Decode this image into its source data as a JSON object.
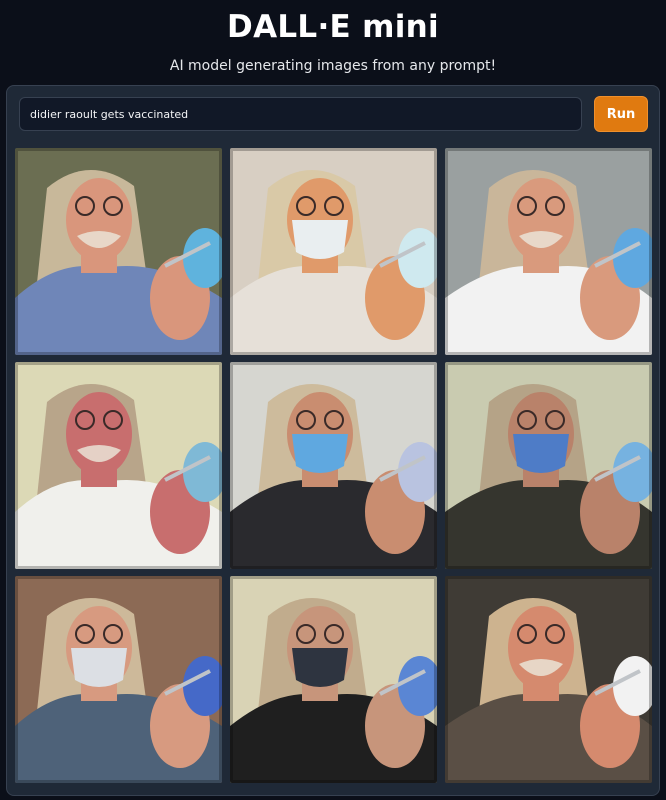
{
  "app": {
    "title": "DALL·E mini",
    "subtitle": "AI model generating images from any prompt!"
  },
  "prompt": {
    "value": "didier raoult gets vaccinated",
    "placeholder": ""
  },
  "run_button": {
    "label": "Run"
  },
  "colors": {
    "background": "#0b0f19",
    "panel": "#1f2937",
    "accent": "#e07a10"
  },
  "gallery": {
    "images": [
      {
        "bg": "#6b6e52",
        "shirt": "#6f86b8",
        "skin": "#d9967c",
        "hair": "#c8b89a",
        "mask": "none",
        "glove": "#5fb3dd"
      },
      {
        "bg": "#d8cfc3",
        "shirt": "#e6e0d8",
        "skin": "#e09a6a",
        "hair": "#d9c9a7",
        "mask": "#e9eef0",
        "glove": "#cfe9ef"
      },
      {
        "bg": "#9aa0a0",
        "shirt": "#f2f2f2",
        "skin": "#d99a7d",
        "hair": "#c9b69a",
        "mask": "none",
        "glove": "#5fa8e0"
      },
      {
        "bg": "#dcd9b6",
        "shirt": "#f0f0ec",
        "skin": "#c86e6e",
        "hair": "#b8a58a",
        "mask": "none",
        "glove": "#7fb9d6"
      },
      {
        "bg": "#d6d6d0",
        "shirt": "#2a2a2e",
        "skin": "#c98d70",
        "hair": "#cdbb9c",
        "mask": "#5fa8e0",
        "glove": "#b9c3e0"
      },
      {
        "bg": "#c9cbb0",
        "shirt": "#35352e",
        "skin": "#b9826a",
        "hair": "#b5a387",
        "mask": "#4e7cc7",
        "glove": "#76b2e0"
      },
      {
        "bg": "#8c6a55",
        "shirt": "#4e6279",
        "skin": "#d79a80",
        "hair": "#cdb99a",
        "mask": "#dcdfe4",
        "glove": "#4569c8"
      },
      {
        "bg": "#d9d3b5",
        "shirt": "#1f1f1f",
        "skin": "#c7957b",
        "hair": "#c1ac8d",
        "mask": "#2e3440",
        "glove": "#5a86d4"
      },
      {
        "bg": "#3f3b35",
        "shirt": "#5a4f45",
        "skin": "#d58a6e",
        "hair": "#cdb38f",
        "mask": "none",
        "glove": "#f2f2f2"
      }
    ]
  }
}
